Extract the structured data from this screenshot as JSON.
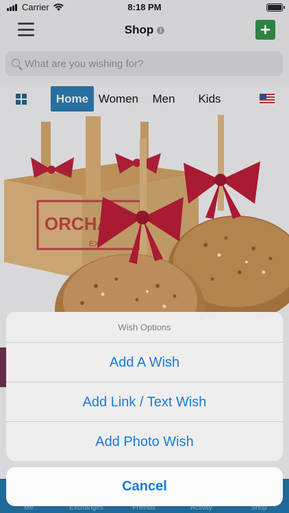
{
  "status_bar": {
    "carrier": "Carrier",
    "time": "8:18 PM"
  },
  "nav": {
    "title": "Shop"
  },
  "search": {
    "placeholder": "What are you wishing for?"
  },
  "categories": {
    "items": [
      "Home",
      "Women",
      "Men",
      "Kids"
    ],
    "selected": "Home"
  },
  "hero": {
    "crate_text": "ORCHAR",
    "crate_subtext": "EX"
  },
  "tab_bar": {
    "items": [
      "Me",
      "Exchanges",
      "Friends",
      "Activity",
      "Shop"
    ]
  },
  "action_sheet": {
    "title": "Wish Options",
    "options": [
      "Add A Wish",
      "Add Link / Text Wish",
      "Add Photo Wish"
    ],
    "cancel": "Cancel"
  },
  "colors": {
    "accent": "#1b7ad6",
    "brand_blue": "#2876a8",
    "add_green": "#2e8b46"
  }
}
